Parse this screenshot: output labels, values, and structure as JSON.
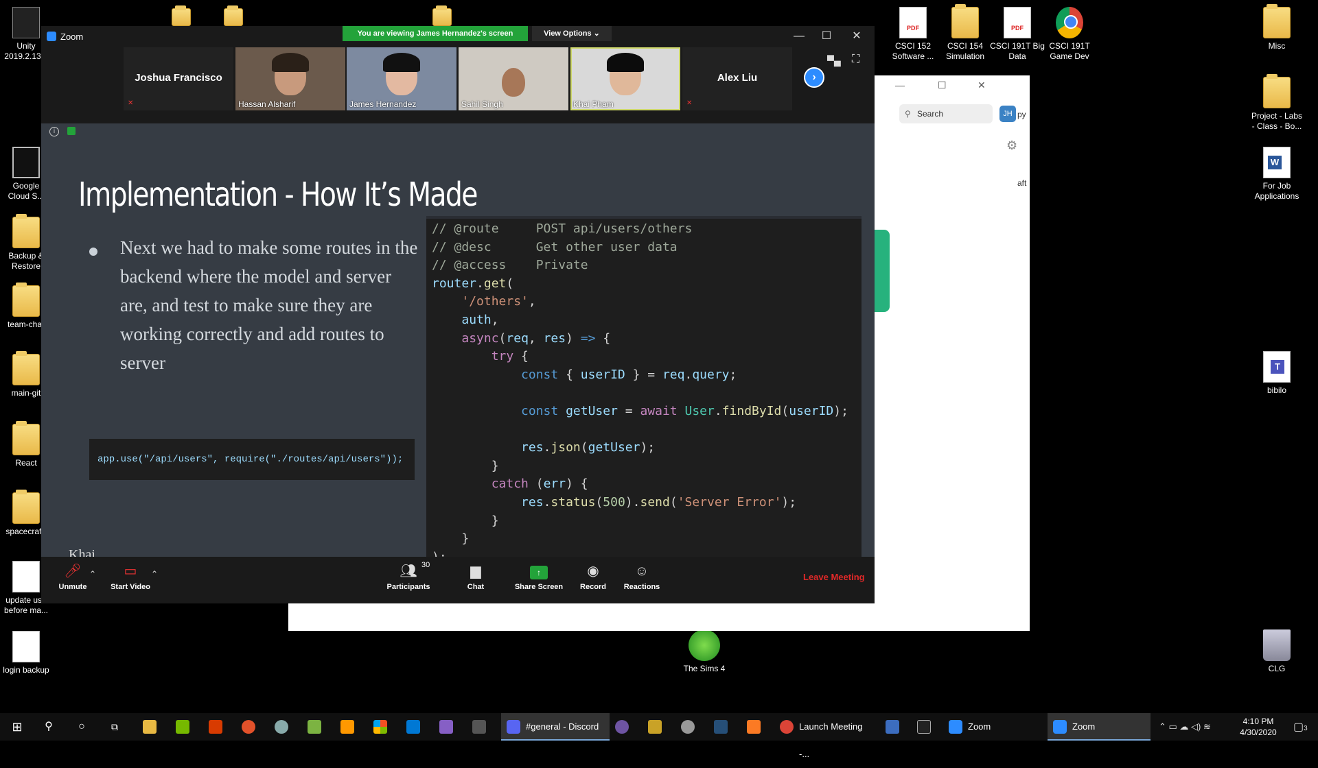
{
  "desktop": {
    "left_icons": [
      {
        "label": "Unity\n2019.2.13...",
        "type": "unity"
      },
      {
        "label": "Google\nCloud S...",
        "type": "cmd"
      },
      {
        "label": "Backup &\nRestore",
        "type": "folder"
      },
      {
        "label": "team-char",
        "type": "folder"
      },
      {
        "label": "main-git",
        "type": "folder"
      },
      {
        "label": "React",
        "type": "folder"
      },
      {
        "label": "spacecraft-",
        "type": "folder"
      },
      {
        "label": "update use\nbefore ma...",
        "type": "docfile"
      },
      {
        "label": "login backup",
        "type": "docfile"
      }
    ],
    "right_icons": [
      {
        "label": "CSCI 152\nSoftware ...",
        "type": "pdf"
      },
      {
        "label": "CSCI 154\nSimulation",
        "type": "folder"
      },
      {
        "label": "CSCI 191T Big\nData",
        "type": "pdf"
      },
      {
        "label": "CSCI 191T\nGame Dev",
        "type": "chrome"
      },
      {
        "label": "Misc",
        "type": "folder"
      },
      {
        "label": "Project - Labs\n- Class - Bo...",
        "type": "folder"
      },
      {
        "label": "For Job\nApplications",
        "type": "word"
      },
      {
        "label": "bibilo",
        "type": "teams"
      },
      {
        "label": "CLG",
        "type": "bin"
      },
      {
        "label": "The Sims 4",
        "type": "sims"
      }
    ]
  },
  "background_window": {
    "search_placeholder": "Search",
    "avatar_initials": "JH",
    "partial_texts": [
      "py",
      "aft"
    ]
  },
  "zoom": {
    "window_title": "Zoom",
    "viewing_banner": "You are viewing James Hernandez's screen",
    "view_options": "View Options ⌄",
    "participants": [
      {
        "name": "Joshua Francisco",
        "video": false,
        "muted": true
      },
      {
        "name": "Hassan Alsharif",
        "video": true
      },
      {
        "name": "James Hernandez",
        "video": true
      },
      {
        "name": "Sahil Singh",
        "video": true
      },
      {
        "name": "Khai Pham",
        "video": true,
        "active": true
      },
      {
        "name": "Alex Liu",
        "video": false,
        "muted": true
      }
    ],
    "slide": {
      "title": "Implementation - How It’s Made",
      "bullet": "Next we had to make some routes in the backend where the model and server are, and test to make sure they are working correctly and add routes to server",
      "small_code": "app.use(\"/api/users\", require(\"./routes/api/users\"));",
      "cut_off_text": "Khai",
      "code_lines": [
        "// @route     POST api/users/others",
        "// @desc      Get other user data",
        "// @access    Private",
        "router.get(",
        "    '/others',",
        "    auth,",
        "    async(req, res) => {",
        "        try {",
        "            const { userID } = req.query;",
        "",
        "            const getUser = await User.findById(userID);",
        "",
        "            res.json(getUser);",
        "        }",
        "        catch (err) {",
        "            res.status(500).send('Server Error');",
        "        }",
        "    }",
        ");"
      ]
    },
    "toolbar": {
      "unmute": "Unmute",
      "start_video": "Start Video",
      "participants": "Participants",
      "participant_count": "30",
      "chat": "Chat",
      "share_screen": "Share Screen",
      "record": "Record",
      "reactions": "Reactions",
      "leave": "Leave Meeting"
    }
  },
  "taskbar": {
    "apps": [
      {
        "label": "#general - Discord",
        "color": "#5865f2"
      },
      {
        "label": "Launch Meeting -...",
        "color": "#db4437"
      },
      {
        "label": "Zoom",
        "color": "#2d8cff"
      },
      {
        "label": "Zoom",
        "color": "#2d8cff"
      }
    ],
    "time": "4:10 PM",
    "date": "4/30/2020",
    "notification_count": "3"
  }
}
